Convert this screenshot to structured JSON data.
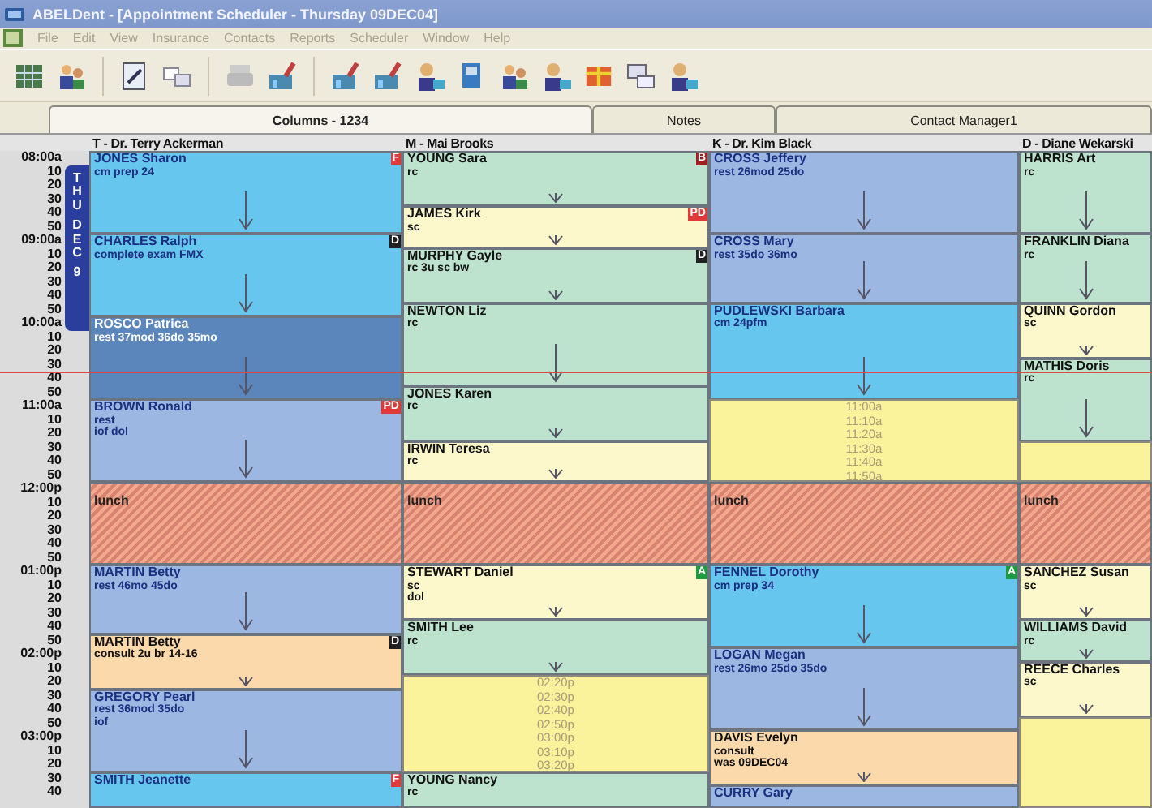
{
  "window": {
    "title": "ABELDent - [Appointment Scheduler - Thursday 09DEC04]"
  },
  "menu": [
    "File",
    "Edit",
    "View",
    "Insurance",
    "Contacts",
    "Reports",
    "Scheduler",
    "Window",
    "Help"
  ],
  "tabs": [
    {
      "label": "Columns - 1234",
      "selected": true
    },
    {
      "label": "Notes",
      "selected": false
    },
    {
      "label": "Contact Manager1",
      "selected": false
    }
  ],
  "time_rows": [
    {
      "label": "08:00a",
      "now": false
    },
    {
      "label": "10",
      "now": false
    },
    {
      "label": "20",
      "now": false
    },
    {
      "label": "30",
      "now": false
    },
    {
      "label": "40",
      "now": false
    },
    {
      "label": "50",
      "now": false
    },
    {
      "label": "09:00a",
      "now": false
    },
    {
      "label": "10",
      "now": false
    },
    {
      "label": "20",
      "now": false
    },
    {
      "label": "30",
      "now": false
    },
    {
      "label": "40",
      "now": false
    },
    {
      "label": "50",
      "now": false
    },
    {
      "label": "10:00a",
      "now": false
    },
    {
      "label": "10",
      "now": false
    },
    {
      "label": "20",
      "now": false
    },
    {
      "label": "30",
      "now": false
    },
    {
      "label": "40",
      "now": true
    },
    {
      "label": "50",
      "now": false
    },
    {
      "label": "11:00a",
      "now": false
    },
    {
      "label": "10",
      "now": false
    },
    {
      "label": "20",
      "now": false
    },
    {
      "label": "30",
      "now": false
    },
    {
      "label": "40",
      "now": false
    },
    {
      "label": "50",
      "now": false
    },
    {
      "label": "12:00p",
      "now": false
    },
    {
      "label": "10",
      "now": false
    },
    {
      "label": "20",
      "now": false
    },
    {
      "label": "30",
      "now": false
    },
    {
      "label": "40",
      "now": false
    },
    {
      "label": "50",
      "now": false
    },
    {
      "label": "01:00p",
      "now": false
    },
    {
      "label": "10",
      "now": false
    },
    {
      "label": "20",
      "now": false
    },
    {
      "label": "30",
      "now": false
    },
    {
      "label": "40",
      "now": false
    },
    {
      "label": "50",
      "now": false
    },
    {
      "label": "02:00p",
      "now": false
    },
    {
      "label": "10",
      "now": false
    },
    {
      "label": "20",
      "now": false
    },
    {
      "label": "30",
      "now": false
    },
    {
      "label": "40",
      "now": false
    },
    {
      "label": "50",
      "now": false
    },
    {
      "label": "03:00p",
      "now": false
    },
    {
      "label": "10",
      "now": false
    },
    {
      "label": "20",
      "now": false
    },
    {
      "label": "30",
      "now": false
    },
    {
      "label": "40",
      "now": false
    }
  ],
  "date_badge": [
    "THU",
    "DEC",
    "9"
  ],
  "columns": [
    {
      "header": "T - Dr. Terry Ackerman",
      "slots": [
        {
          "kind": "appointment",
          "name": "JONES Sharon",
          "notes": [
            "cm prep 24"
          ],
          "color": "#66c6ee",
          "flag": {
            "text": "F",
            "color": "#e03a3a"
          }
        },
        {
          "kind": "cont"
        },
        {
          "kind": "cont"
        },
        {
          "kind": "cont"
        },
        {
          "kind": "cont"
        },
        {
          "kind": "cont"
        },
        {
          "kind": "appointment",
          "name": "CHARLES Ralph",
          "notes": [
            "complete exam FMX"
          ],
          "color": "#66c6ee",
          "flag": {
            "text": "D",
            "color": "#202020"
          }
        },
        {
          "kind": "cont"
        },
        {
          "kind": "cont"
        },
        {
          "kind": "cont"
        },
        {
          "kind": "cont"
        },
        {
          "kind": "cont"
        },
        {
          "kind": "appointment",
          "name": "ROSCO Patrica",
          "notes": [
            "rest 37mod 36do 35mo"
          ],
          "color": "#5a86bc"
        },
        {
          "kind": "cont"
        },
        {
          "kind": "cont"
        },
        {
          "kind": "cont"
        },
        {
          "kind": "cont"
        },
        {
          "kind": "cont"
        },
        {
          "kind": "appointment",
          "name": "BROWN Ronald",
          "notes": [
            "rest",
            "iof dol"
          ],
          "color": "#9cb8e2",
          "flag": {
            "text": "PD",
            "color": "#e03a3a"
          }
        },
        {
          "kind": "cont"
        },
        {
          "kind": "cont"
        },
        {
          "kind": "cont"
        },
        {
          "kind": "cont"
        },
        {
          "kind": "cont"
        },
        {
          "kind": "lunch",
          "label": "lunch"
        },
        {
          "kind": "cont"
        },
        {
          "kind": "cont"
        },
        {
          "kind": "cont"
        },
        {
          "kind": "cont"
        },
        {
          "kind": "cont"
        },
        {
          "kind": "appointment",
          "name": "MARTIN Betty",
          "notes": [
            "rest 46mo 45do"
          ],
          "color": "#9cb8e2"
        },
        {
          "kind": "cont"
        },
        {
          "kind": "cont"
        },
        {
          "kind": "cont"
        },
        {
          "kind": "cont"
        },
        {
          "kind": "appointment",
          "name": "MARTIN Betty",
          "notes": [
            "consult 2u br 14-16"
          ],
          "color": "#fcd9aa",
          "flag": {
            "text": "D",
            "color": "#202020"
          }
        },
        {
          "kind": "cont"
        },
        {
          "kind": "cont"
        },
        {
          "kind": "cont"
        },
        {
          "kind": "appointment",
          "name": "GREGORY Pearl",
          "notes": [
            "rest  36mod 35do",
            "iof"
          ],
          "color": "#9cb8e2"
        },
        {
          "kind": "cont"
        },
        {
          "kind": "cont"
        },
        {
          "kind": "cont"
        },
        {
          "kind": "cont"
        },
        {
          "kind": "cont"
        },
        {
          "kind": "appointment",
          "name": "SMITH Jeanette",
          "color": "#66c6ee",
          "flag": {
            "text": "F",
            "color": "#e03a3a"
          }
        },
        {
          "kind": "cont"
        }
      ]
    },
    {
      "header": "M - Mai Brooks",
      "slots": [
        {
          "kind": "appointment",
          "name": "YOUNG Sara",
          "notes": [
            "rc"
          ],
          "color": "#bde3cf",
          "flag": {
            "text": "B",
            "color": "#a02020"
          }
        },
        {
          "kind": "cont"
        },
        {
          "kind": "cont"
        },
        {
          "kind": "cont"
        },
        {
          "kind": "appointment",
          "name": "JAMES Kirk",
          "notes": [
            "sc"
          ],
          "color": "#fdf8cc",
          "flag": {
            "text": "PD",
            "color": "#e03a3a"
          }
        },
        {
          "kind": "cont"
        },
        {
          "kind": "cont"
        },
        {
          "kind": "appointment",
          "name": "MURPHY Gayle",
          "notes": [
            "rc 3u sc bw"
          ],
          "color": "#bde3cf",
          "flag": {
            "text": "D",
            "color": "#202020"
          }
        },
        {
          "kind": "cont"
        },
        {
          "kind": "cont"
        },
        {
          "kind": "cont"
        },
        {
          "kind": "appointment",
          "name": "NEWTON Liz",
          "notes": [
            "rc"
          ],
          "color": "#bde3cf"
        },
        {
          "kind": "cont"
        },
        {
          "kind": "cont"
        },
        {
          "kind": "cont"
        },
        {
          "kind": "cont"
        },
        {
          "kind": "cont"
        },
        {
          "kind": "appointment",
          "name": "JONES Karen",
          "notes": [
            "rc"
          ],
          "color": "#bde3cf"
        },
        {
          "kind": "cont"
        },
        {
          "kind": "cont"
        },
        {
          "kind": "cont"
        },
        {
          "kind": "appointment",
          "name": "IRWIN Teresa",
          "notes": [
            "rc"
          ],
          "color": "#fdf8cc"
        },
        {
          "kind": "cont"
        },
        {
          "kind": "cont"
        },
        {
          "kind": "lunch",
          "label": "lunch"
        },
        {
          "kind": "cont"
        },
        {
          "kind": "cont"
        },
        {
          "kind": "cont"
        },
        {
          "kind": "cont"
        },
        {
          "kind": "cont"
        },
        {
          "kind": "appointment",
          "name": "STEWART Daniel",
          "notes": [
            "sc",
            "dol"
          ],
          "color": "#fdf8cc",
          "flag": {
            "text": "A",
            "color": "#1c9c3c"
          }
        },
        {
          "kind": "cont"
        },
        {
          "kind": "cont"
        },
        {
          "kind": "cont"
        },
        {
          "kind": "appointment",
          "name": "SMITH Lee",
          "notes": [
            "rc"
          ],
          "color": "#bde3cf"
        },
        {
          "kind": "cont"
        },
        {
          "kind": "cont"
        },
        {
          "kind": "cont"
        },
        {
          "kind": "open",
          "times": [
            "02:20p",
            "02:30p",
            "02:40p",
            "02:50p",
            "03:00p",
            "03:10p",
            "03:20p"
          ]
        },
        {
          "kind": "cont"
        },
        {
          "kind": "cont"
        },
        {
          "kind": "cont"
        },
        {
          "kind": "cont"
        },
        {
          "kind": "cont"
        },
        {
          "kind": "cont"
        },
        {
          "kind": "appointment",
          "name": "YOUNG Nancy",
          "notes": [
            "rc"
          ],
          "color": "#bde3cf"
        },
        {
          "kind": "cont"
        }
      ]
    },
    {
      "header": "K - Dr. Kim Black",
      "slots": [
        {
          "kind": "appointment",
          "name": "CROSS Jeffery",
          "notes": [
            "rest 26mod 25do"
          ],
          "color": "#9cb8e2"
        },
        {
          "kind": "cont"
        },
        {
          "kind": "cont"
        },
        {
          "kind": "cont"
        },
        {
          "kind": "cont"
        },
        {
          "kind": "cont"
        },
        {
          "kind": "appointment",
          "name": "CROSS Mary",
          "notes": [
            "rest  35do 36mo"
          ],
          "color": "#9cb8e2"
        },
        {
          "kind": "cont"
        },
        {
          "kind": "cont"
        },
        {
          "kind": "cont"
        },
        {
          "kind": "cont"
        },
        {
          "kind": "appointment",
          "name": "PUDLEWSKI Barbara",
          "notes": [
            "cm 24pfm"
          ],
          "color": "#66c6ee"
        },
        {
          "kind": "cont"
        },
        {
          "kind": "cont"
        },
        {
          "kind": "cont"
        },
        {
          "kind": "cont"
        },
        {
          "kind": "cont"
        },
        {
          "kind": "cont"
        },
        {
          "kind": "open",
          "times": [
            "11:00a",
            "11:10a",
            "11:20a",
            "11:30a",
            "11:40a",
            "11:50a"
          ]
        },
        {
          "kind": "cont"
        },
        {
          "kind": "cont"
        },
        {
          "kind": "cont"
        },
        {
          "kind": "cont"
        },
        {
          "kind": "cont"
        },
        {
          "kind": "lunch",
          "label": "lunch"
        },
        {
          "kind": "cont"
        },
        {
          "kind": "cont"
        },
        {
          "kind": "cont"
        },
        {
          "kind": "cont"
        },
        {
          "kind": "cont"
        },
        {
          "kind": "appointment",
          "name": "FENNEL Dorothy",
          "notes": [
            "cm prep 34"
          ],
          "color": "#66c6ee",
          "flag": {
            "text": "A",
            "color": "#1c9c3c"
          }
        },
        {
          "kind": "cont"
        },
        {
          "kind": "cont"
        },
        {
          "kind": "cont"
        },
        {
          "kind": "cont"
        },
        {
          "kind": "cont"
        },
        {
          "kind": "appointment",
          "name": "LOGAN Megan",
          "notes": [
            "rest 26mo 25do 35do"
          ],
          "color": "#9cb8e2"
        },
        {
          "kind": "cont"
        },
        {
          "kind": "cont"
        },
        {
          "kind": "cont"
        },
        {
          "kind": "cont"
        },
        {
          "kind": "cont"
        },
        {
          "kind": "appointment",
          "name": "DAVIS Evelyn",
          "notes": [
            "consult",
            "was 09DEC04"
          ],
          "color": "#fcd9aa"
        },
        {
          "kind": "cont"
        },
        {
          "kind": "cont"
        },
        {
          "kind": "cont"
        },
        {
          "kind": "appointment",
          "name": "CURRY Gary",
          "color": "#9cb8e2"
        }
      ]
    },
    {
      "header": "D - Diane Wekarski",
      "slots": [
        {
          "kind": "appointment",
          "name": "HARRIS Art",
          "notes": [
            "rc"
          ],
          "color": "#bde3cf"
        },
        {
          "kind": "cont"
        },
        {
          "kind": "cont"
        },
        {
          "kind": "cont"
        },
        {
          "kind": "cont"
        },
        {
          "kind": "cont"
        },
        {
          "kind": "appointment",
          "name": "FRANKLIN Diana",
          "notes": [
            "rc"
          ],
          "color": "#bde3cf"
        },
        {
          "kind": "cont"
        },
        {
          "kind": "cont"
        },
        {
          "kind": "cont"
        },
        {
          "kind": "cont"
        },
        {
          "kind": "appointment",
          "name": "QUINN Gordon",
          "notes": [
            "sc"
          ],
          "color": "#fdf8cc"
        },
        {
          "kind": "cont"
        },
        {
          "kind": "cont"
        },
        {
          "kind": "cont"
        },
        {
          "kind": "appointment",
          "name": "MATHIS Doris",
          "notes": [
            "rc"
          ],
          "color": "#bde3cf"
        },
        {
          "kind": "cont"
        },
        {
          "kind": "cont"
        },
        {
          "kind": "cont"
        },
        {
          "kind": "cont"
        },
        {
          "kind": "cont"
        },
        {
          "kind": "open"
        },
        {
          "kind": "cont"
        },
        {
          "kind": "cont"
        },
        {
          "kind": "lunch",
          "label": "lunch"
        },
        {
          "kind": "cont"
        },
        {
          "kind": "cont"
        },
        {
          "kind": "cont"
        },
        {
          "kind": "cont"
        },
        {
          "kind": "cont"
        },
        {
          "kind": "appointment",
          "name": "SANCHEZ Susan",
          "notes": [
            "sc"
          ],
          "color": "#fdf8cc"
        },
        {
          "kind": "cont"
        },
        {
          "kind": "cont"
        },
        {
          "kind": "cont"
        },
        {
          "kind": "appointment",
          "name": "WILLIAMS David",
          "notes": [
            "rc"
          ],
          "color": "#bde3cf"
        },
        {
          "kind": "cont"
        },
        {
          "kind": "cont"
        },
        {
          "kind": "appointment",
          "name": "REECE Charles",
          "notes": [
            "sc"
          ],
          "color": "#fdf8cc"
        },
        {
          "kind": "cont"
        },
        {
          "kind": "cont"
        },
        {
          "kind": "cont"
        },
        {
          "kind": "open"
        },
        {
          "kind": "cont"
        },
        {
          "kind": "cont"
        },
        {
          "kind": "cont"
        },
        {
          "kind": "cont"
        },
        {
          "kind": "cont"
        }
      ]
    }
  ]
}
